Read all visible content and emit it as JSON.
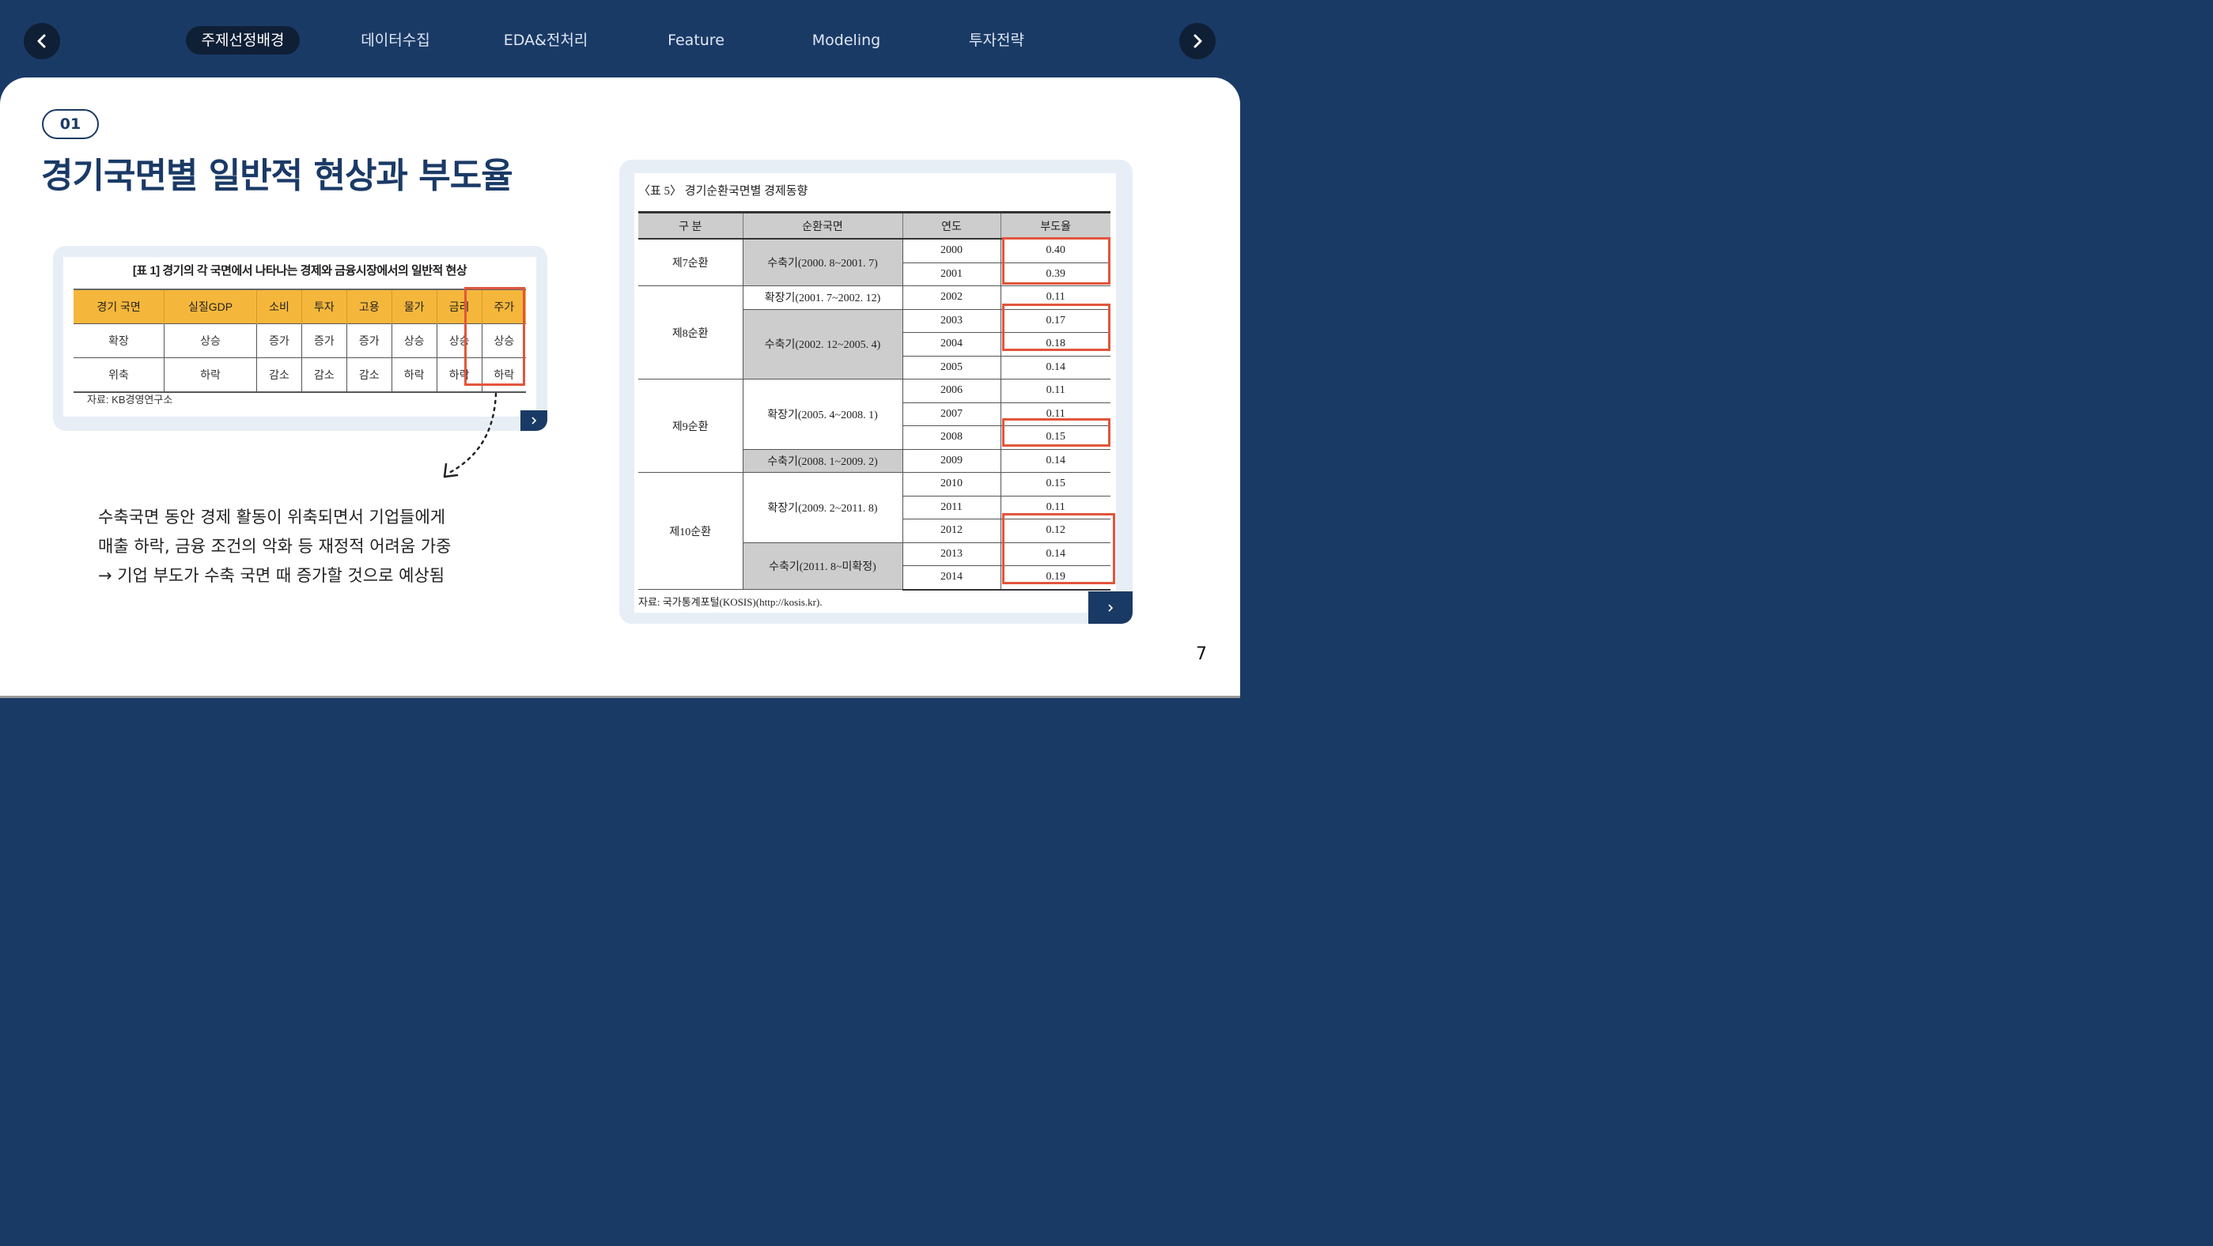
{
  "nav": {
    "prev_icon": "chevron-left-icon",
    "next_icon": "chevron-right-icon",
    "tabs": [
      {
        "label": "주제선정배경",
        "active": true
      },
      {
        "label": "데이터수집",
        "active": false
      },
      {
        "label": "EDA&전처리",
        "active": false
      },
      {
        "label": "Feature",
        "active": false
      },
      {
        "label": "Modeling",
        "active": false
      },
      {
        "label": "투자전략",
        "active": false
      }
    ]
  },
  "section_number": "01",
  "title": "경기국면별 일반적 현상과 부도율",
  "table1": {
    "caption": "[표 1] 경기의 각 국면에서 나타나는 경제와 금융시장에서의 일반적 현상",
    "headers": [
      "경기 국면",
      "실질GDP",
      "소비",
      "투자",
      "고용",
      "물가",
      "금리",
      "주가"
    ],
    "rows": [
      [
        "확장",
        "상승",
        "증가",
        "증가",
        "증가",
        "상승",
        "상승",
        "상승"
      ],
      [
        "위축",
        "하락",
        "감소",
        "감소",
        "감소",
        "하락",
        "하락",
        "하락"
      ]
    ],
    "source": "자료: KB경영연구소"
  },
  "body": {
    "line1": "수축국면 동안 경제 활동이 위축되면서 기업들에게",
    "line2": "매출 하락, 금융 조건의 악화 등  재정적 어려움 가중",
    "line3": "→ 기업 부도가 수축 국면 때 증가할 것으로 예상됨"
  },
  "table5": {
    "caption": "〈표 5〉 경기순환국면별 경제동향",
    "headers": [
      "구 분",
      "순환국면",
      "연도",
      "부도율"
    ],
    "cycles": [
      "제7순환",
      "제8순환",
      "제9순환",
      "제10순환"
    ],
    "phases": [
      "수축기(2000. 8~2001. 7)",
      "확장기(2001. 7~2002. 12)",
      "수축기(2002. 12~2005. 4)",
      "확장기(2005. 4~2008. 1)",
      "수축기(2008. 1~2009. 2)",
      "확장기(2009. 2~2011. 8)",
      "수축기(2011. 8~미확정)"
    ],
    "years": [
      "2000",
      "2001",
      "2002",
      "2003",
      "2004",
      "2005",
      "2006",
      "2007",
      "2008",
      "2009",
      "2010",
      "2011",
      "2012",
      "2013",
      "2014"
    ],
    "rates": [
      "0.40",
      "0.39",
      "0.11",
      "0.17",
      "0.18",
      "0.14",
      "0.11",
      "0.11",
      "0.15",
      "0.14",
      "0.15",
      "0.11",
      "0.12",
      "0.14",
      "0.19"
    ],
    "source": "자료: 국가통계포털(KOSIS)(http://kosis.kr)."
  },
  "page_number": "7",
  "colors": {
    "navy": "#1a3a66",
    "highlight": "#e2553c",
    "header_yellow": "#f5b73b",
    "grey_cell": "#cdcdcd"
  }
}
